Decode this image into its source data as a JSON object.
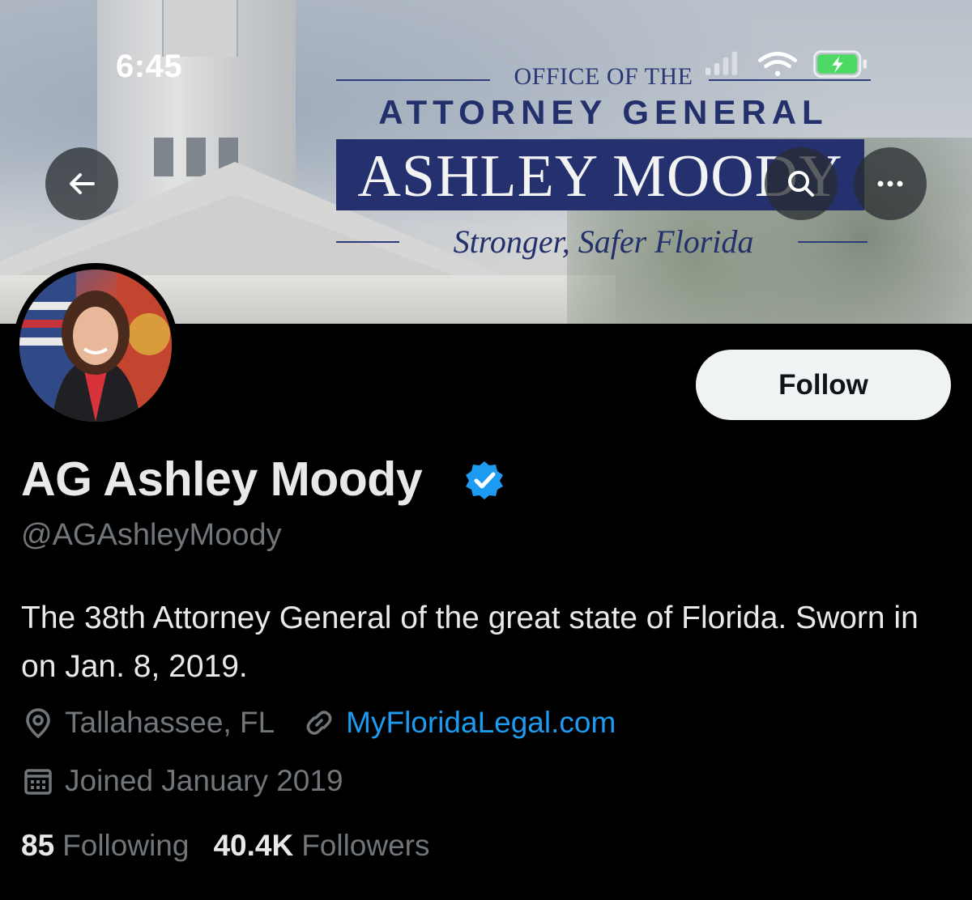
{
  "status_bar": {
    "time": "6:45"
  },
  "banner": {
    "office_text": "OFFICE OF THE",
    "title_text": "ATTORNEY GENERAL",
    "name_text": "ASHLEY MOODY",
    "tagline_text": "Stronger, Safer Florida"
  },
  "nav": {
    "back_icon": "arrow-left-icon",
    "search_icon": "search-icon",
    "more_icon": "more-horizontal-icon"
  },
  "profile": {
    "display_name": "AG Ashley Moody",
    "handle": "@AGAshleyMoody",
    "bio": "The 38th Attorney General of the great state of Florida. Sworn in on Jan. 8, 2019.",
    "location": "Tallahassee, FL",
    "website": "MyFloridaLegal.com",
    "joined": "Joined January 2019",
    "following_count": "85",
    "following_label": "Following",
    "followers_count": "40.4K",
    "followers_label": "Followers",
    "follow_button": "Follow",
    "verified_color": "#1d9bf0"
  },
  "colors": {
    "link": "#1d9bf0",
    "muted": "#71767b",
    "text": "#e7e9ea",
    "background": "#000000"
  }
}
